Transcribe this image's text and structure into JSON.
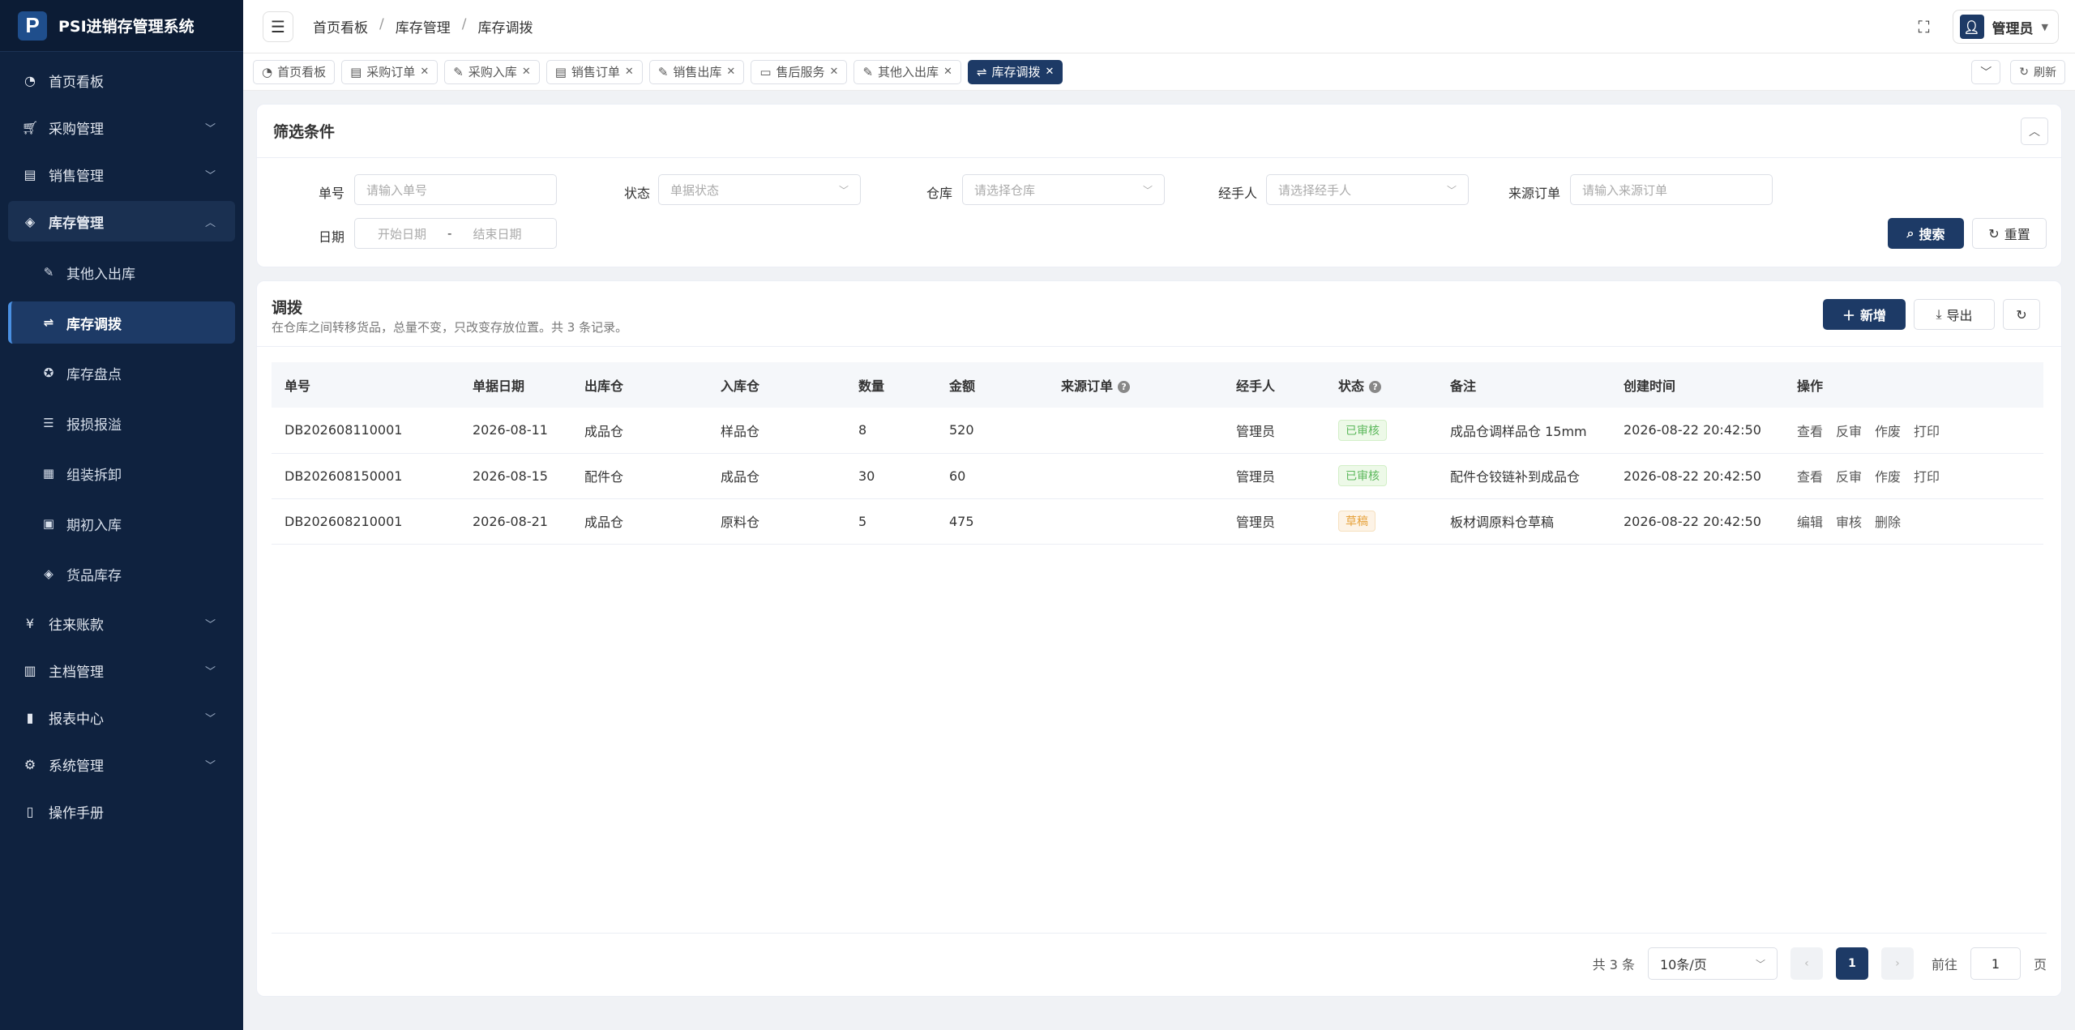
{
  "app": {
    "logo_letter": "P",
    "title": "PSI进销存管理系统"
  },
  "sidebar": {
    "items": [
      {
        "label": "首页看板",
        "icon": "dashboard-icon"
      },
      {
        "label": "采购管理",
        "icon": "cart-icon"
      },
      {
        "label": "销售管理",
        "icon": "sales-icon"
      },
      {
        "label": "库存管理",
        "icon": "layers-icon"
      }
    ],
    "sub_items": [
      {
        "label": "其他入出库",
        "icon": "edit-icon"
      },
      {
        "label": "库存调拨",
        "icon": "transfer-icon"
      },
      {
        "label": "库存盘点",
        "icon": "aperture-icon"
      },
      {
        "label": "报损报溢",
        "icon": "list-icon"
      },
      {
        "label": "组装拆卸",
        "icon": "grid-icon"
      },
      {
        "label": "期初入库",
        "icon": "calendar-icon"
      },
      {
        "label": "货品库存",
        "icon": "stack-icon"
      }
    ],
    "bottom_items": [
      {
        "label": "往来账款",
        "icon": "yen-icon"
      },
      {
        "label": "主档管理",
        "icon": "archive-icon"
      },
      {
        "label": "报表中心",
        "icon": "chart-icon"
      },
      {
        "label": "系统管理",
        "icon": "gear-icon"
      },
      {
        "label": "操作手册",
        "icon": "book-icon"
      }
    ]
  },
  "header": {
    "breadcrumb": [
      "首页看板",
      "库存管理",
      "库存调拨"
    ],
    "user": "管理员"
  },
  "tabs": [
    {
      "label": "首页看板",
      "closable": false
    },
    {
      "label": "采购订单",
      "closable": true
    },
    {
      "label": "采购入库",
      "closable": true
    },
    {
      "label": "销售订单",
      "closable": true
    },
    {
      "label": "销售出库",
      "closable": true
    },
    {
      "label": "售后服务",
      "closable": true
    },
    {
      "label": "其他入出库",
      "closable": true
    },
    {
      "label": "库存调拨",
      "closable": true
    }
  ],
  "tabs_actions": {
    "refresh": "刷新"
  },
  "filter": {
    "title": "筛选条件",
    "order_no_label": "单号",
    "order_no_placeholder": "请输入单号",
    "status_label": "状态",
    "status_placeholder": "单据状态",
    "warehouse_label": "仓库",
    "warehouse_placeholder": "请选择仓库",
    "handler_label": "经手人",
    "handler_placeholder": "请选择经手人",
    "source_label": "来源订单",
    "source_placeholder": "请输入来源订单",
    "date_label": "日期",
    "date_start": "开始日期",
    "date_sep": "-",
    "date_end": "结束日期",
    "search": "搜索",
    "reset": "重置"
  },
  "table_card": {
    "title": "调拨",
    "subtitle": "在仓库之间转移货品，总量不变，只改变存放位置。共 3 条记录。",
    "add": "新增",
    "export": "导出"
  },
  "columns": [
    "单号",
    "单据日期",
    "出库仓",
    "入库仓",
    "数量",
    "金额",
    "来源订单",
    "经手人",
    "状态",
    "备注",
    "创建时间",
    "操作"
  ],
  "rows": [
    {
      "no": "DB202608110001",
      "date": "2026-08-11",
      "out": "成品仓",
      "in": "样品仓",
      "qty": "8",
      "amount": "520",
      "source": "",
      "handler": "管理员",
      "status": "已审核",
      "status_type": "ok",
      "note": "成品仓调样品仓 15mm",
      "created": "2026-08-22 20:42:50",
      "ops": [
        "查看",
        "反审",
        "作废",
        "打印"
      ]
    },
    {
      "no": "DB202608150001",
      "date": "2026-08-15",
      "out": "配件仓",
      "in": "成品仓",
      "qty": "30",
      "amount": "60",
      "source": "",
      "handler": "管理员",
      "status": "已审核",
      "status_type": "ok",
      "note": "配件仓铰链补到成品仓",
      "created": "2026-08-22 20:42:50",
      "ops": [
        "查看",
        "反审",
        "作废",
        "打印"
      ]
    },
    {
      "no": "DB202608210001",
      "date": "2026-08-21",
      "out": "成品仓",
      "in": "原料仓",
      "qty": "5",
      "amount": "475",
      "source": "",
      "handler": "管理员",
      "status": "草稿",
      "status_type": "draft",
      "note": "板材调原料仓草稿",
      "created": "2026-08-22 20:42:50",
      "ops": [
        "编辑",
        "审核",
        "删除"
      ]
    }
  ],
  "pager": {
    "total": "共 3 条",
    "page_size": "10条/页",
    "current": "1",
    "goto": "前往",
    "goto_value": "1",
    "page_unit": "页"
  }
}
